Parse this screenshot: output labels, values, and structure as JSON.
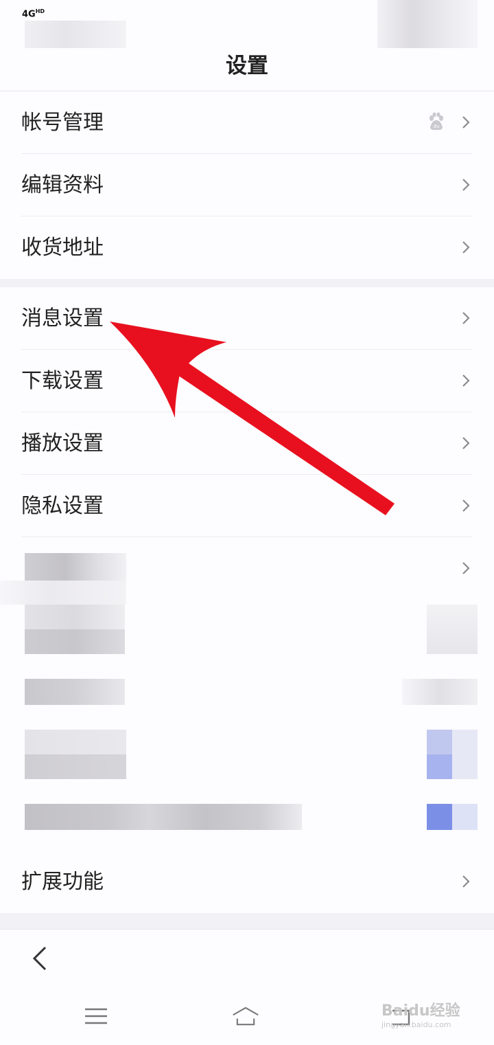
{
  "status_bar": {
    "network": "4G",
    "network_sup": "HD"
  },
  "header": {
    "title": "设置"
  },
  "groups": [
    {
      "items": [
        {
          "label": "帐号管理",
          "icon": "baidu-paw-icon"
        },
        {
          "label": "编辑资料"
        },
        {
          "label": "收货地址"
        }
      ]
    },
    {
      "items": [
        {
          "label": "消息设置"
        },
        {
          "label": "下载设置"
        },
        {
          "label": "播放设置"
        },
        {
          "label": "隐私设置"
        }
      ]
    },
    {
      "items": [
        {
          "label": "扩展功能"
        }
      ]
    }
  ],
  "bottom_nav": {
    "back_icon": "chevron-left-icon",
    "menu_icon": "hamburger-icon",
    "home_icon": "home-icon",
    "recent_icon": "recent-apps-icon"
  },
  "watermark": {
    "text": "Baidu经验",
    "url": "jingyan.baidu.com"
  },
  "colors": {
    "arrow": "#e8101f",
    "accent_blue": "#7b8fe6"
  }
}
